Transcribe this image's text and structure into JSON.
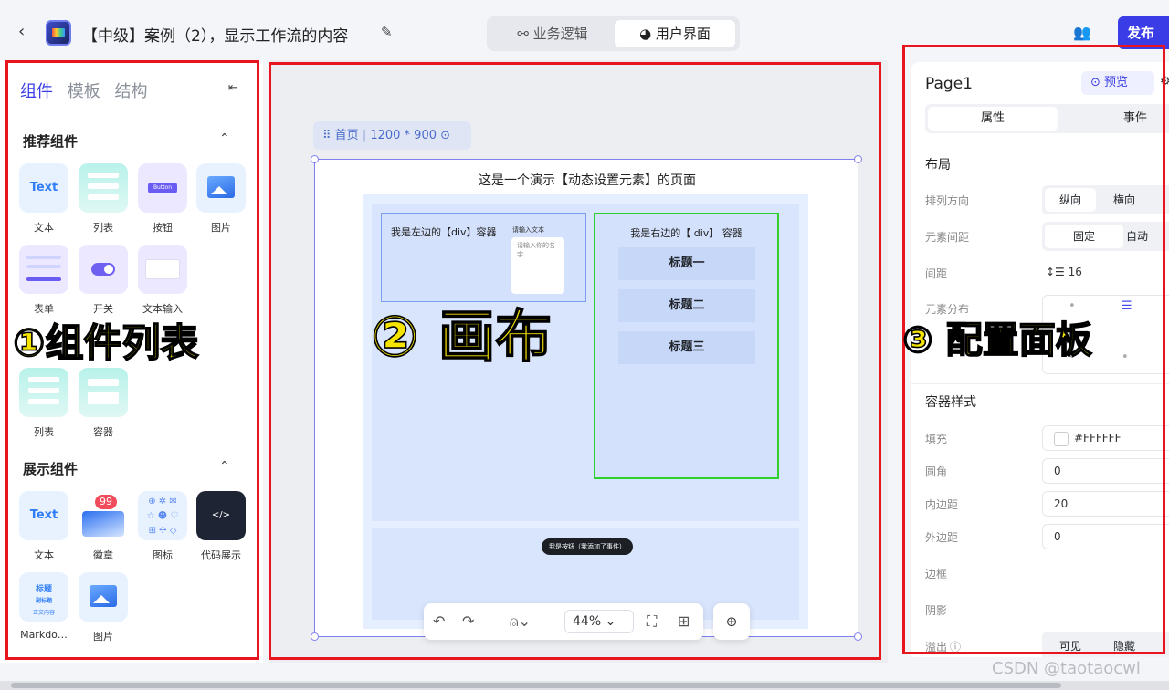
{
  "header": {
    "title": "【中级】案例（2），显示工作流的内容",
    "modes": [
      "业务逻辑",
      "用户界面"
    ],
    "publish": "发布"
  },
  "left": {
    "tabs": [
      "组件",
      "模板",
      "结构"
    ],
    "sections": {
      "recommended": "推荐组件",
      "display": "展示组件"
    },
    "recommended_items": [
      "文本",
      "列表",
      "按钮",
      "图片",
      "表单",
      "开关",
      "文本输入"
    ],
    "layout_items": [
      "列表",
      "容器"
    ],
    "display_items": [
      "文本",
      "徽章",
      "图标",
      "代码展示",
      "Markdo…",
      "图片"
    ],
    "icon_text": "Text",
    "icon_button": "Button",
    "badge_count": "99",
    "md_icon_lines": [
      "标题",
      "副标题",
      "正文内容"
    ]
  },
  "annotations": {
    "a1": "①组件列表",
    "a2": "② 画布",
    "a3": "③ 配置面板"
  },
  "canvas": {
    "page_name": "首页",
    "page_size": "1200 * 900",
    "page_title": "这是一个演示【动态设置元素】的页面",
    "left_div": "我是左边的【div】容器",
    "input_label": "请输入文本",
    "input_placeholder": "请输入你的名字",
    "right_div": "我是右边的【 div】 容器",
    "headings": [
      "标题一",
      "标题二",
      "标题三"
    ],
    "event_button": "我是按钮（我添加了事件）",
    "zoom": "44%"
  },
  "right": {
    "page": "Page1",
    "preview": "预览",
    "tabs": [
      "属性",
      "事件"
    ],
    "layout_section": "布局",
    "direction_label": "排列方向",
    "direction_opts": [
      "纵向",
      "横向"
    ],
    "spacing_label": "元素间距",
    "spacing_opts": [
      "固定",
      "自动"
    ],
    "gap_label": "间距",
    "gap_value": "16",
    "distribution_label": "元素分布",
    "style_section": "容器样式",
    "fill_label": "填充",
    "fill_value": "#FFFFFF",
    "radius_label": "圆角",
    "radius_value": "0",
    "padding_label": "内边距",
    "padding_value": "20",
    "margin_label": "外边距",
    "margin_value": "0",
    "border_label": "边框",
    "shadow_label": "阴影",
    "overflow_label": "溢出",
    "overflow_opts": [
      "可见",
      "隐藏"
    ]
  },
  "watermark": "CSDN @taotaocwl"
}
